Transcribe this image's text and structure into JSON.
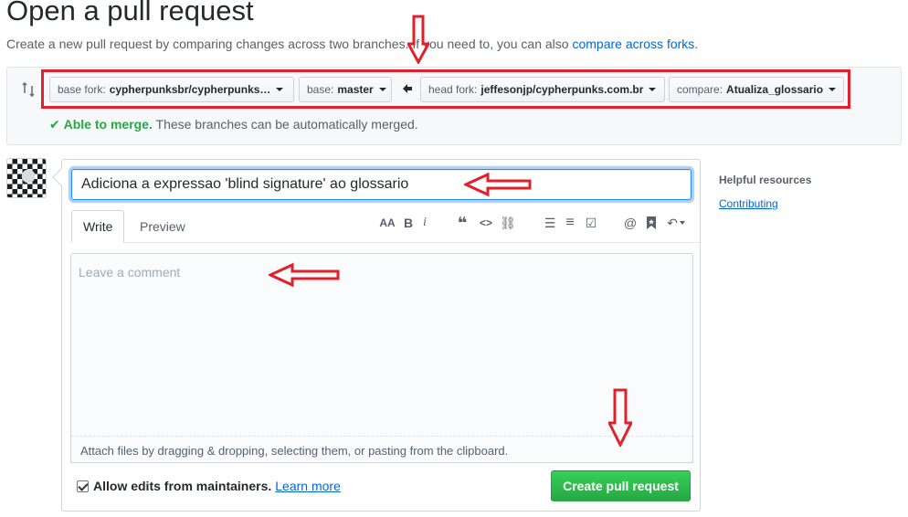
{
  "header": {
    "title": "Open a pull request",
    "subtitle_prefix": "Create a new pull request by comparing changes across two branches. If you need to, you can also ",
    "compare_forks_link": "compare across forks",
    "subtitle_suffix": "."
  },
  "range": {
    "base_fork": {
      "label": "base fork:",
      "value": "cypherpunksbr/cypherpunks…"
    },
    "base": {
      "label": "base:",
      "value": "master"
    },
    "head_fork": {
      "label": "head fork:",
      "value": "jeffesonjp/cypherpunks.com.br"
    },
    "compare": {
      "label": "compare:",
      "value": "Atualiza_glossario"
    },
    "merge_status_bold": "Able to merge.",
    "merge_status_text": " These branches can be automatically merged."
  },
  "form": {
    "title_value": "Adiciona a expressao 'blind signature' ao glossario",
    "tabs": [
      {
        "label": "Write",
        "active": true
      },
      {
        "label": "Preview",
        "active": false
      }
    ],
    "toolbar": {
      "header_icon": "AA",
      "bold_icon": "B",
      "italic_icon": "i",
      "quote_icon": "❝",
      "code_icon": "<>",
      "link_icon": "⛓",
      "ul_icon": "☰",
      "ol_icon": "≡",
      "task_icon": "☑",
      "mention_icon": "@",
      "bookmark_icon": "🔖",
      "reply_icon": "↶"
    },
    "comment_placeholder": "Leave a comment",
    "attach_text": "Attach files by dragging & dropping, selecting them, or pasting from the clipboard.",
    "allow_edits_label": "Allow edits from maintainers.",
    "allow_edits_checked": true,
    "learn_more": "Learn more",
    "submit_label": "Create pull request"
  },
  "sidebar": {
    "heading": "Helpful resources",
    "link": "Contributing"
  },
  "colors": {
    "accent": "#0366d6",
    "success": "#28a745",
    "annotation": "#e0202a"
  }
}
